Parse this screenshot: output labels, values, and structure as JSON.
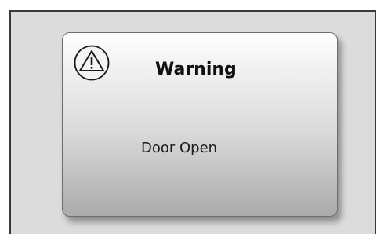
{
  "dialog": {
    "icon": "warning-triangle-icon",
    "title": "Warning",
    "message": "Door Open"
  }
}
